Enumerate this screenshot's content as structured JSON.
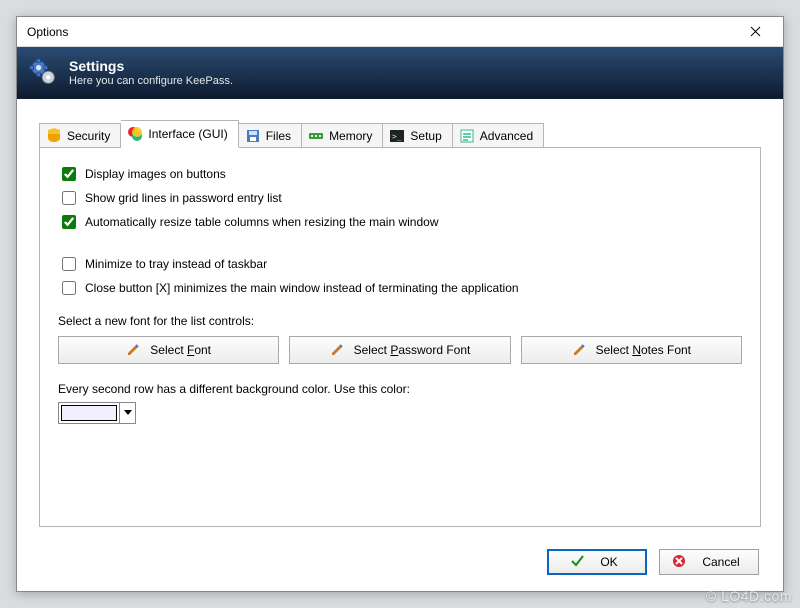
{
  "window": {
    "title": "Options"
  },
  "banner": {
    "title": "Settings",
    "subtitle": "Here you can configure KeePass."
  },
  "tabs": [
    {
      "label": "Security"
    },
    {
      "label": "Interface (GUI)",
      "active": true
    },
    {
      "label": "Files"
    },
    {
      "label": "Memory"
    },
    {
      "label": "Setup"
    },
    {
      "label": "Advanced"
    }
  ],
  "checks": {
    "displayImages": {
      "label": "Display images on buttons",
      "checked": true
    },
    "gridLines": {
      "label": "Show grid lines in password entry list",
      "checked": false
    },
    "autoResize": {
      "label": "Automatically resize table columns when resizing the main window",
      "checked": true
    },
    "minimizeTray": {
      "label": "Minimize to tray instead of taskbar",
      "checked": false
    },
    "closeMinimizes": {
      "label": "Close button [X] minimizes the main window instead of terminating the application",
      "checked": false
    }
  },
  "fontSection": {
    "label": "Select a new font for the list controls:",
    "buttons": {
      "selectFont": "Select Font",
      "selectPasswordFont": "Select Password Font",
      "selectNotesFont": "Select Notes Font"
    }
  },
  "colorSection": {
    "label": "Every second row has a different background color. Use this color:",
    "color": "#f0f0ff"
  },
  "footer": {
    "ok": "OK",
    "cancel": "Cancel"
  },
  "watermark": "© LO4D.com"
}
